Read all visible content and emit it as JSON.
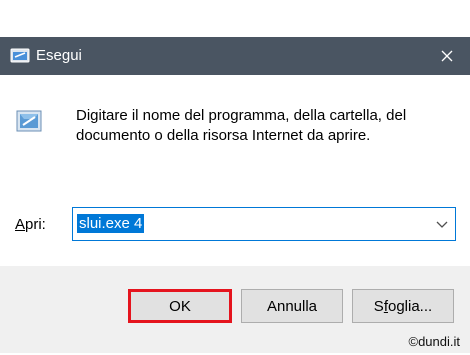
{
  "window": {
    "title": "Esegui",
    "close_symbol": "✕",
    "titlebar_color": "#4a5562"
  },
  "dialog": {
    "description": "Digitare il nome del programma, della cartella, del documento o della risorsa Internet da aprire.",
    "icon": "run-dialog-icon",
    "open_label_accel": "A",
    "open_label_rest": "pri:",
    "input_value": "slui.exe 4",
    "selection_color": "#0078d7"
  },
  "buttons": {
    "ok": "OK",
    "cancel": "Annulla",
    "browse_before": "S",
    "browse_accel": "f",
    "browse_after": "oglia...",
    "highlight_color": "#e5141e"
  },
  "watermark": "©dundi.it"
}
